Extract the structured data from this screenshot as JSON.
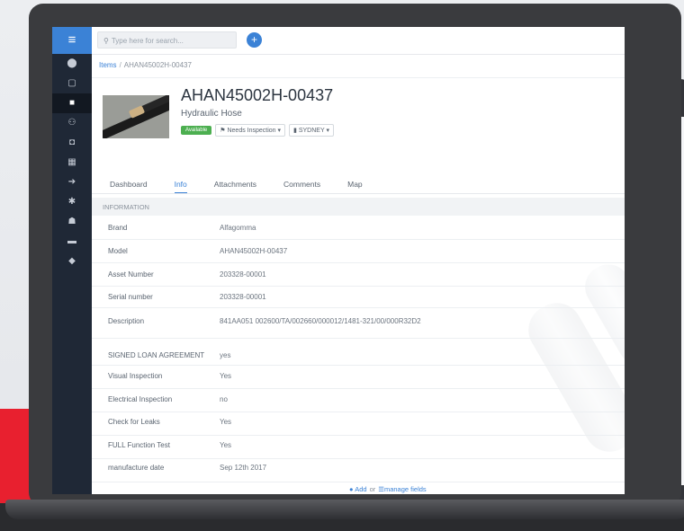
{
  "search": {
    "placeholder": "Type here for search..."
  },
  "breadcrumb": {
    "root": "Items",
    "separator": "/",
    "current": "AHAN45002H-00437"
  },
  "asset": {
    "title": "AHAN45002H-00437",
    "subtitle": "Hydraulic Hose",
    "status": "Available",
    "inspection": "Needs Inspection",
    "location": "SYDNEY"
  },
  "tabs": [
    "Dashboard",
    "Info",
    "Attachments",
    "Comments",
    "Map"
  ],
  "section": {
    "title": "INFORMATION"
  },
  "fields": [
    {
      "label": "Brand",
      "value": "Alfagomma"
    },
    {
      "label": "Model",
      "value": "AHAN45002H-00437"
    },
    {
      "label": "Asset Number",
      "value": "203328-00001"
    },
    {
      "label": "Serial number",
      "value": "203328-00001"
    },
    {
      "label": "Description",
      "value": "841AA051 002600/TA/002660/000012/1481-321/00/000R32D2"
    },
    {
      "label": "SIGNED LOAN AGREEMENT",
      "value": "yes"
    },
    {
      "label": "Visual Inspection",
      "value": "Yes"
    },
    {
      "label": "Electrical Inspection",
      "value": "no"
    },
    {
      "label": "Check for Leaks",
      "value": "Yes"
    },
    {
      "label": "FULL Function Test",
      "value": "Yes"
    },
    {
      "label": "manufacture date",
      "value": "Sep 12th 2017"
    }
  ],
  "footer": {
    "add_label": "Add",
    "or_label": "or",
    "manage_label": "manage fields"
  },
  "icons": {
    "menu": "hamburger-icon",
    "nav": [
      "dashboard-icon",
      "calendar-icon",
      "grid-icon",
      "users-icon",
      "box-icon",
      "schedule-icon",
      "signin-icon",
      "settings-icon",
      "group-icon",
      "card-icon",
      "tag-icon"
    ]
  },
  "colors": {
    "accent": "#3b82d6",
    "nav_bg": "#1f2836",
    "available": "#4caf50",
    "red_block": "#e8202f"
  }
}
